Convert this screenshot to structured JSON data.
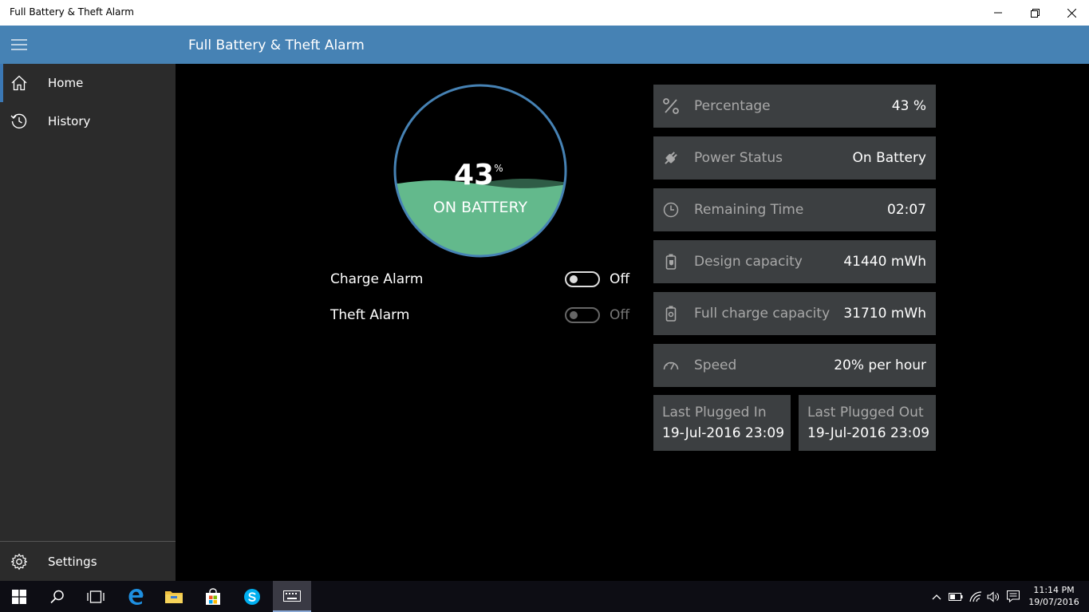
{
  "window": {
    "title": "Full Battery & Theft Alarm"
  },
  "header": {
    "title": "Full Battery & Theft Alarm"
  },
  "sidebar": {
    "items": [
      {
        "label": "Home",
        "icon": "home-icon",
        "active": true
      },
      {
        "label": "History",
        "icon": "history-icon",
        "active": false
      }
    ],
    "settings_label": "Settings"
  },
  "gauge": {
    "percent_value": "43",
    "percent_symbol": "%",
    "status": "ON BATTERY",
    "level": 0.43,
    "fill_color": "#63b98c",
    "ring_color": "#4682b4"
  },
  "alarms": [
    {
      "label": "Charge Alarm",
      "state": "Off",
      "enabled": true
    },
    {
      "label": "Theft Alarm",
      "state": "Off",
      "enabled": false
    }
  ],
  "info_cards": [
    {
      "icon": "percent-icon",
      "label": "Percentage",
      "value": "43 %"
    },
    {
      "icon": "plug-icon",
      "label": "Power Status",
      "value": "On Battery"
    },
    {
      "icon": "clock-icon",
      "label": "Remaining Time",
      "value": "02:07"
    },
    {
      "icon": "battery-design-icon",
      "label": "Design capacity",
      "value": "41440 mWh"
    },
    {
      "icon": "battery-full-icon",
      "label": "Full charge capacity",
      "value": "31710 mWh"
    },
    {
      "icon": "speedometer-icon",
      "label": "Speed",
      "value": "20% per hour"
    }
  ],
  "plug_cards": [
    {
      "label": "Last Plugged In",
      "value": "19-Jul-2016 23:09"
    },
    {
      "label": "Last Plugged Out",
      "value": "19-Jul-2016 23:09"
    }
  ],
  "taskbar": {
    "time": "11:14 PM",
    "date": "19/07/2016",
    "accent": "#8aa9d6"
  }
}
